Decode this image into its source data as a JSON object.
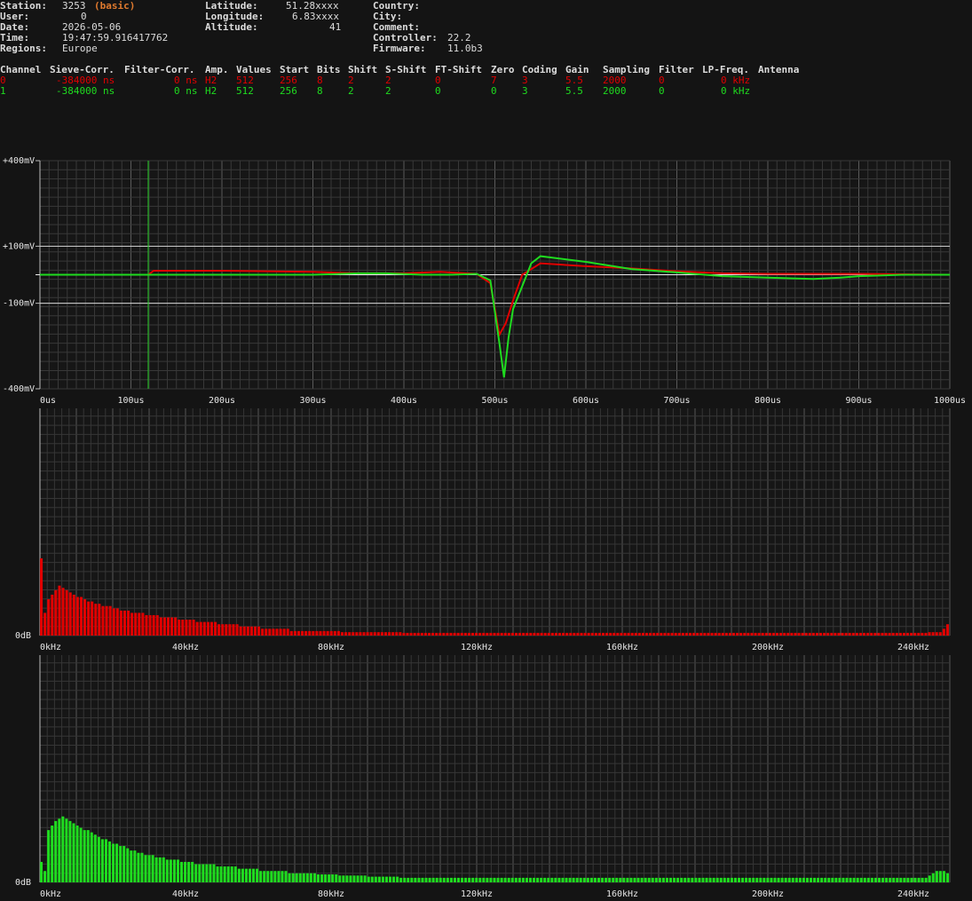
{
  "header": {
    "station_label": "Station:",
    "station_value": "3253",
    "station_tag": "(basic)",
    "user_label": "User:",
    "user_value": "0",
    "date_label": "Date:",
    "date_value": "2026-05-06",
    "time_label": "Time:",
    "time_value": "19:47:59.916417762",
    "regions_label": "Regions:",
    "regions_value": "Europe",
    "latitude_label": "Latitude:",
    "latitude_value": "51.28xxxx",
    "longitude_label": "Longitude:",
    "longitude_value": "6.83xxxx",
    "altitude_label": "Altitude:",
    "altitude_value": "41",
    "country_label": "Country:",
    "city_label": "City:",
    "comment_label": "Comment:",
    "controller_label": "Controller:",
    "controller_value": "22.2",
    "firmware_label": "Firmware:",
    "firmware_value": "11.0b3"
  },
  "channel_table": {
    "columns": [
      "Channel",
      "Sieve-Corr.",
      "Filter-Corr.",
      "Amp.",
      "Values",
      "Start",
      "Bits",
      "Shift",
      "S-Shift",
      "FT-Shift",
      "Zero",
      "Coding",
      "Gain",
      "Sampling",
      "Filter",
      "LP-Freq.",
      "Antenna"
    ],
    "rows": [
      {
        "channel": "0",
        "sieve": "-384000 ns",
        "filter_corr": "0 ns",
        "amp": "H2",
        "values": "512",
        "start": "256",
        "bits": "8",
        "shift": "2",
        "s_shift": "2",
        "ft_shift": "0",
        "zero": "7",
        "coding": "3",
        "gain": "5.5",
        "sampling": "2000",
        "filter": "0",
        "lp_freq": "0 kHz",
        "color": "#e00000"
      },
      {
        "channel": "1",
        "sieve": "-384000 ns",
        "filter_corr": "0 ns",
        "amp": "H2",
        "values": "512",
        "start": "256",
        "bits": "8",
        "shift": "2",
        "s_shift": "2",
        "ft_shift": "0",
        "zero": "0",
        "coding": "3",
        "gain": "5.5",
        "sampling": "2000",
        "filter": "0",
        "lp_freq": "0 kHz",
        "color": "#1fdc1f"
      }
    ]
  },
  "chart_data": [
    {
      "type": "line",
      "xlabel": "",
      "ylabel": "",
      "xlim": [
        0,
        1000
      ],
      "ylim": [
        -400,
        400
      ],
      "x_ticks": [
        "0us",
        "100us",
        "200us",
        "300us",
        "400us",
        "500us",
        "600us",
        "700us",
        "800us",
        "900us",
        "1000us"
      ],
      "y_ticks": [
        "+400mV",
        "+100mV",
        "-100mV",
        "-400mV"
      ],
      "y_tick_values": [
        400,
        100,
        -100,
        -400
      ],
      "marker_us": 119,
      "series": [
        {
          "color": "#e00000",
          "x": [
            0,
            119,
            125,
            200,
            250,
            300,
            350,
            400,
            440,
            480,
            495,
            505,
            512,
            520,
            530,
            550,
            575,
            600,
            650,
            700,
            750,
            800,
            850,
            900,
            1000
          ],
          "y": [
            0,
            0,
            14,
            14,
            12,
            10,
            5,
            5,
            10,
            3,
            -30,
            -210,
            -170,
            -90,
            0,
            40,
            35,
            30,
            22,
            12,
            5,
            3,
            3,
            3,
            0
          ]
        },
        {
          "color": "#1fdc1f",
          "x": [
            0,
            100,
            150,
            200,
            250,
            300,
            350,
            380,
            420,
            450,
            480,
            495,
            505,
            510,
            515,
            520,
            530,
            540,
            550,
            600,
            650,
            700,
            750,
            800,
            850,
            880,
            900,
            950,
            1000
          ],
          "y": [
            0,
            0,
            0,
            0,
            0,
            0,
            5,
            5,
            0,
            0,
            3,
            -20,
            -240,
            -360,
            -220,
            -120,
            -40,
            40,
            65,
            45,
            20,
            8,
            -5,
            -10,
            -15,
            -10,
            -5,
            0,
            0
          ]
        }
      ]
    },
    {
      "type": "bar",
      "series_color": "#e00000",
      "xlim": [
        0,
        250
      ],
      "x_ticks": [
        "0kHz",
        "40kHz",
        "80kHz",
        "120kHz",
        "160kHz",
        "200kHz",
        "240kHz"
      ],
      "y_tick": "0dB",
      "ylim": [
        0,
        1
      ],
      "values": [
        0.34,
        0.1,
        0.16,
        0.18,
        0.2,
        0.22,
        0.21,
        0.2,
        0.19,
        0.18,
        0.17,
        0.17,
        0.16,
        0.15,
        0.15,
        0.14,
        0.14,
        0.13,
        0.13,
        0.13,
        0.12,
        0.12,
        0.11,
        0.11,
        0.11,
        0.1,
        0.1,
        0.1,
        0.1,
        0.09,
        0.09,
        0.09,
        0.09,
        0.08,
        0.08,
        0.08,
        0.08,
        0.08,
        0.07,
        0.07,
        0.07,
        0.07,
        0.07,
        0.06,
        0.06,
        0.06,
        0.06,
        0.06,
        0.06,
        0.05,
        0.05,
        0.05,
        0.05,
        0.05,
        0.05,
        0.04,
        0.04,
        0.04,
        0.04,
        0.04,
        0.04,
        0.03,
        0.03,
        0.03,
        0.03,
        0.03,
        0.03,
        0.03,
        0.03,
        0.02,
        0.02,
        0.02,
        0.02,
        0.02,
        0.02,
        0.02,
        0.02,
        0.02,
        0.02,
        0.02,
        0.02,
        0.02,
        0.02,
        0.015,
        0.015,
        0.015,
        0.015,
        0.015,
        0.015,
        0.015,
        0.015,
        0.015,
        0.015,
        0.015,
        0.015,
        0.015,
        0.015,
        0.015,
        0.015,
        0.015,
        0.012,
        0.012,
        0.012,
        0.012,
        0.012,
        0.012,
        0.012,
        0.012,
        0.012,
        0.012,
        0.012,
        0.012,
        0.012,
        0.012,
        0.012,
        0.012,
        0.012,
        0.012,
        0.012,
        0.012,
        0.012,
        0.012,
        0.012,
        0.012,
        0.012,
        0.012,
        0.012,
        0.012,
        0.012,
        0.012,
        0.012,
        0.012,
        0.012,
        0.012,
        0.012,
        0.012,
        0.012,
        0.012,
        0.012,
        0.012,
        0.012,
        0.012,
        0.012,
        0.012,
        0.012,
        0.012,
        0.012,
        0.012,
        0.012,
        0.012,
        0.012,
        0.012,
        0.012,
        0.012,
        0.012,
        0.012,
        0.012,
        0.012,
        0.012,
        0.012,
        0.012,
        0.012,
        0.012,
        0.012,
        0.012,
        0.012,
        0.012,
        0.012,
        0.012,
        0.012,
        0.012,
        0.012,
        0.012,
        0.012,
        0.012,
        0.012,
        0.012,
        0.012,
        0.012,
        0.012,
        0.012,
        0.012,
        0.012,
        0.012,
        0.012,
        0.012,
        0.012,
        0.012,
        0.012,
        0.012,
        0.012,
        0.012,
        0.012,
        0.012,
        0.012,
        0.012,
        0.012,
        0.012,
        0.012,
        0.012,
        0.012,
        0.012,
        0.012,
        0.012,
        0.012,
        0.012,
        0.012,
        0.012,
        0.012,
        0.012,
        0.012,
        0.012,
        0.012,
        0.012,
        0.012,
        0.012,
        0.012,
        0.012,
        0.012,
        0.012,
        0.012,
        0.012,
        0.012,
        0.012,
        0.012,
        0.012,
        0.012,
        0.012,
        0.012,
        0.012,
        0.012,
        0.012,
        0.012,
        0.012,
        0.012,
        0.012,
        0.012,
        0.012,
        0.012,
        0.012,
        0.012,
        0.012,
        0.012,
        0.012,
        0.012,
        0.015,
        0.015,
        0.015,
        0.015,
        0.03,
        0.05
      ]
    },
    {
      "type": "bar",
      "series_color": "#1fdc1f",
      "xlim": [
        0,
        250
      ],
      "x_ticks": [
        "0kHz",
        "40kHz",
        "80kHz",
        "120kHz",
        "160kHz",
        "200kHz",
        "240kHz"
      ],
      "y_tick": "0dB",
      "ylim": [
        0,
        1
      ],
      "values": [
        0.09,
        0.05,
        0.23,
        0.25,
        0.27,
        0.28,
        0.29,
        0.28,
        0.27,
        0.26,
        0.25,
        0.24,
        0.23,
        0.23,
        0.22,
        0.21,
        0.2,
        0.19,
        0.19,
        0.18,
        0.17,
        0.17,
        0.16,
        0.16,
        0.15,
        0.14,
        0.14,
        0.13,
        0.13,
        0.12,
        0.12,
        0.12,
        0.11,
        0.11,
        0.11,
        0.1,
        0.1,
        0.1,
        0.1,
        0.09,
        0.09,
        0.09,
        0.09,
        0.08,
        0.08,
        0.08,
        0.08,
        0.08,
        0.08,
        0.07,
        0.07,
        0.07,
        0.07,
        0.07,
        0.07,
        0.06,
        0.06,
        0.06,
        0.06,
        0.06,
        0.06,
        0.05,
        0.05,
        0.05,
        0.05,
        0.05,
        0.05,
        0.05,
        0.05,
        0.04,
        0.04,
        0.04,
        0.04,
        0.04,
        0.04,
        0.04,
        0.04,
        0.035,
        0.035,
        0.035,
        0.035,
        0.035,
        0.035,
        0.03,
        0.03,
        0.03,
        0.03,
        0.03,
        0.03,
        0.03,
        0.03,
        0.025,
        0.025,
        0.025,
        0.025,
        0.025,
        0.025,
        0.025,
        0.025,
        0.025,
        0.02,
        0.02,
        0.02,
        0.02,
        0.02,
        0.02,
        0.02,
        0.02,
        0.02,
        0.02,
        0.02,
        0.02,
        0.02,
        0.02,
        0.02,
        0.02,
        0.02,
        0.02,
        0.02,
        0.02,
        0.02,
        0.02,
        0.02,
        0.02,
        0.02,
        0.02,
        0.02,
        0.02,
        0.02,
        0.02,
        0.02,
        0.02,
        0.02,
        0.02,
        0.02,
        0.02,
        0.02,
        0.02,
        0.02,
        0.02,
        0.02,
        0.02,
        0.02,
        0.02,
        0.02,
        0.02,
        0.02,
        0.02,
        0.02,
        0.02,
        0.02,
        0.02,
        0.02,
        0.02,
        0.02,
        0.02,
        0.02,
        0.02,
        0.02,
        0.02,
        0.02,
        0.02,
        0.02,
        0.02,
        0.02,
        0.02,
        0.02,
        0.02,
        0.02,
        0.02,
        0.02,
        0.02,
        0.02,
        0.02,
        0.02,
        0.02,
        0.02,
        0.02,
        0.02,
        0.02,
        0.02,
        0.02,
        0.02,
        0.02,
        0.02,
        0.02,
        0.02,
        0.02,
        0.02,
        0.02,
        0.02,
        0.02,
        0.02,
        0.02,
        0.02,
        0.02,
        0.02,
        0.02,
        0.02,
        0.02,
        0.02,
        0.02,
        0.02,
        0.02,
        0.02,
        0.02,
        0.02,
        0.02,
        0.02,
        0.02,
        0.02,
        0.02,
        0.02,
        0.02,
        0.02,
        0.02,
        0.02,
        0.02,
        0.02,
        0.02,
        0.02,
        0.02,
        0.02,
        0.02,
        0.02,
        0.02,
        0.02,
        0.02,
        0.02,
        0.02,
        0.02,
        0.02,
        0.02,
        0.02,
        0.02,
        0.02,
        0.02,
        0.02,
        0.02,
        0.02,
        0.02,
        0.02,
        0.02,
        0.02,
        0.02,
        0.02,
        0.02,
        0.03,
        0.04,
        0.05,
        0.05,
        0.05,
        0.04
      ]
    }
  ]
}
